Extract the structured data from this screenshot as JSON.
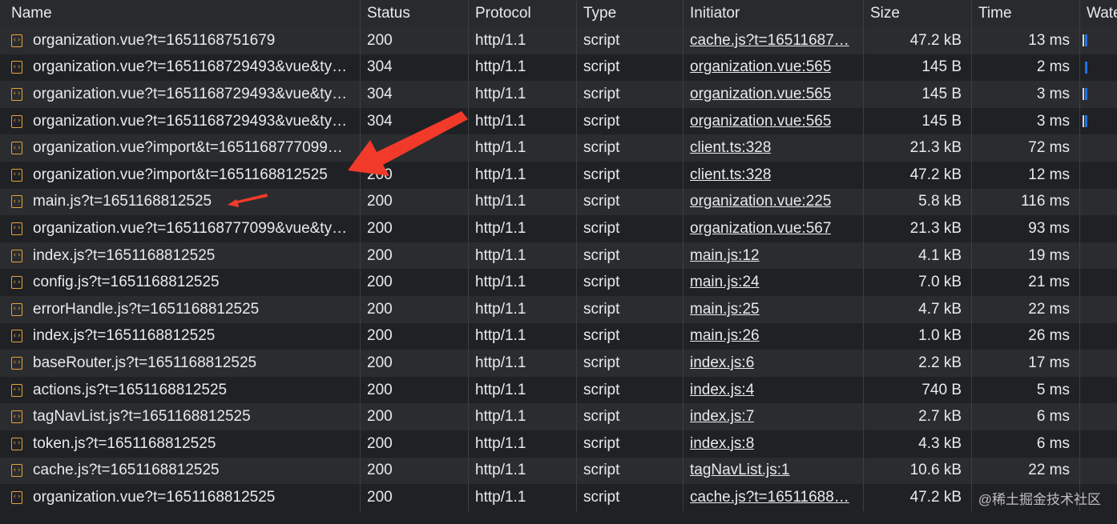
{
  "columns": {
    "name": "Name",
    "status": "Status",
    "protocol": "Protocol",
    "type": "Type",
    "initiator": "Initiator",
    "size": "Size",
    "time": "Time",
    "waterfall": "Wate"
  },
  "rows": [
    {
      "name": "organization.vue?t=1651168751679",
      "status": "200",
      "protocol": "http/1.1",
      "type": "script",
      "initiator": "cache.js?t=16511687…",
      "size": "47.2 kB",
      "time": "13 ms"
    },
    {
      "name": "organization.vue?t=1651168729493&vue&ty…",
      "status": "304",
      "protocol": "http/1.1",
      "type": "script",
      "initiator": "organization.vue:565",
      "size": "145 B",
      "time": "2 ms"
    },
    {
      "name": "organization.vue?t=1651168729493&vue&ty…",
      "status": "304",
      "protocol": "http/1.1",
      "type": "script",
      "initiator": "organization.vue:565",
      "size": "145 B",
      "time": "3 ms"
    },
    {
      "name": "organization.vue?t=1651168729493&vue&ty…",
      "status": "304",
      "protocol": "http/1.1",
      "type": "script",
      "initiator": "organization.vue:565",
      "size": "145 B",
      "time": "3 ms"
    },
    {
      "name": "organization.vue?import&t=1651168777099…",
      "status": "",
      "protocol": "http/1.1",
      "type": "script",
      "initiator": "client.ts:328",
      "size": "21.3 kB",
      "time": "72 ms"
    },
    {
      "name": "organization.vue?import&t=1651168812525",
      "status": "200",
      "protocol": "http/1.1",
      "type": "script",
      "initiator": "client.ts:328",
      "size": "47.2 kB",
      "time": "12 ms"
    },
    {
      "name": "main.js?t=1651168812525",
      "status": "200",
      "protocol": "http/1.1",
      "type": "script",
      "initiator": "organization.vue:225",
      "size": "5.8 kB",
      "time": "116 ms"
    },
    {
      "name": "organization.vue?t=1651168777099&vue&ty…",
      "status": "200",
      "protocol": "http/1.1",
      "type": "script",
      "initiator": "organization.vue:567",
      "size": "21.3 kB",
      "time": "93 ms"
    },
    {
      "name": "index.js?t=1651168812525",
      "status": "200",
      "protocol": "http/1.1",
      "type": "script",
      "initiator": "main.js:12",
      "size": "4.1 kB",
      "time": "19 ms"
    },
    {
      "name": "config.js?t=1651168812525",
      "status": "200",
      "protocol": "http/1.1",
      "type": "script",
      "initiator": "main.js:24",
      "size": "7.0 kB",
      "time": "21 ms"
    },
    {
      "name": "errorHandle.js?t=1651168812525",
      "status": "200",
      "protocol": "http/1.1",
      "type": "script",
      "initiator": "main.js:25",
      "size": "4.7 kB",
      "time": "22 ms"
    },
    {
      "name": "index.js?t=1651168812525",
      "status": "200",
      "protocol": "http/1.1",
      "type": "script",
      "initiator": "main.js:26",
      "size": "1.0 kB",
      "time": "26 ms"
    },
    {
      "name": "baseRouter.js?t=1651168812525",
      "status": "200",
      "protocol": "http/1.1",
      "type": "script",
      "initiator": "index.js:6",
      "size": "2.2 kB",
      "time": "17 ms"
    },
    {
      "name": "actions.js?t=1651168812525",
      "status": "200",
      "protocol": "http/1.1",
      "type": "script",
      "initiator": "index.js:4",
      "size": "740 B",
      "time": "5 ms"
    },
    {
      "name": "tagNavList.js?t=1651168812525",
      "status": "200",
      "protocol": "http/1.1",
      "type": "script",
      "initiator": "index.js:7",
      "size": "2.7 kB",
      "time": "6 ms"
    },
    {
      "name": "token.js?t=1651168812525",
      "status": "200",
      "protocol": "http/1.1",
      "type": "script",
      "initiator": "index.js:8",
      "size": "4.3 kB",
      "time": "6 ms"
    },
    {
      "name": "cache.js?t=1651168812525",
      "status": "200",
      "protocol": "http/1.1",
      "type": "script",
      "initiator": "tagNavList.js:1",
      "size": "10.6 kB",
      "time": "22 ms"
    },
    {
      "name": "organization.vue?t=1651168812525",
      "status": "200",
      "protocol": "http/1.1",
      "type": "script",
      "initiator": "cache.js?t=16511688…",
      "size": "47.2 kB",
      "time": ""
    }
  ],
  "file_icon_glyph": "‹›",
  "colors": {
    "annotation_arrow": "#f23a2a",
    "waterfall_bar": "#1a73e8",
    "file_icon": "#e8a33d"
  },
  "watermark": "@稀土掘金技术社区"
}
